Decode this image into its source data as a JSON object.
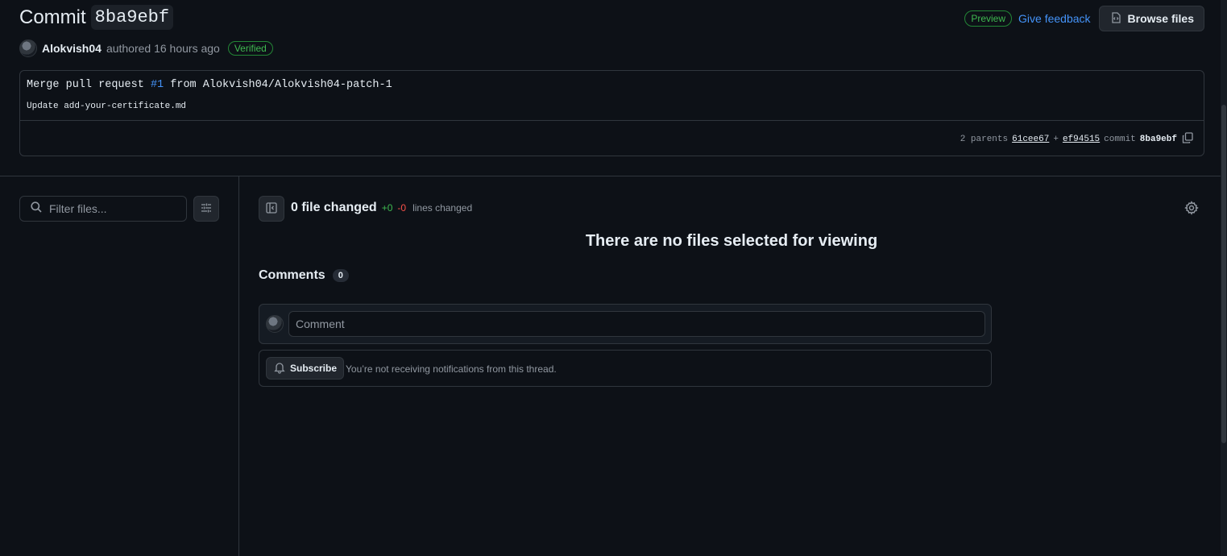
{
  "header": {
    "title_prefix": "Commit",
    "sha": "8ba9ebf",
    "author": "Alokvish04",
    "authored_text": "authored 16 hours ago",
    "verified_label": "Verified",
    "preview_label": "Preview",
    "feedback_label": "Give feedback",
    "browse_label": "Browse files"
  },
  "message": {
    "title_prefix": "Merge pull request",
    "pr_number": "#1",
    "title_suffix": "from Alokvish04/Alokvish04-patch-1",
    "body": "Update add-your-certificate.md",
    "parents_label": "2 parents",
    "parent1": "61cee67",
    "plus": "+",
    "parent2": "ef94515",
    "commit_label": "commit",
    "commit_sha": "8ba9ebf"
  },
  "sidebar": {
    "filter_placeholder": "Filter files..."
  },
  "main": {
    "files_changed": "0 file changed",
    "additions": "+0",
    "deletions": "-0",
    "lines_label": "lines changed",
    "empty_message": "There are no files selected for viewing",
    "comments_label": "Comments",
    "comments_count": "0",
    "comment_placeholder": "Comment",
    "subscribe_label": "Subscribe",
    "subscribe_text": "You’re not receiving notifications from this thread."
  },
  "colors": {
    "background": "#0d1117",
    "border": "#30363d",
    "accent_link": "#4493f8",
    "success": "#3fb950",
    "danger": "#f85149"
  },
  "icons": [
    "search-icon",
    "filter-settings-icon",
    "sidebar-toggle-icon",
    "gear-icon",
    "code-file-icon",
    "copy-icon",
    "bell-icon",
    "avatar"
  ]
}
